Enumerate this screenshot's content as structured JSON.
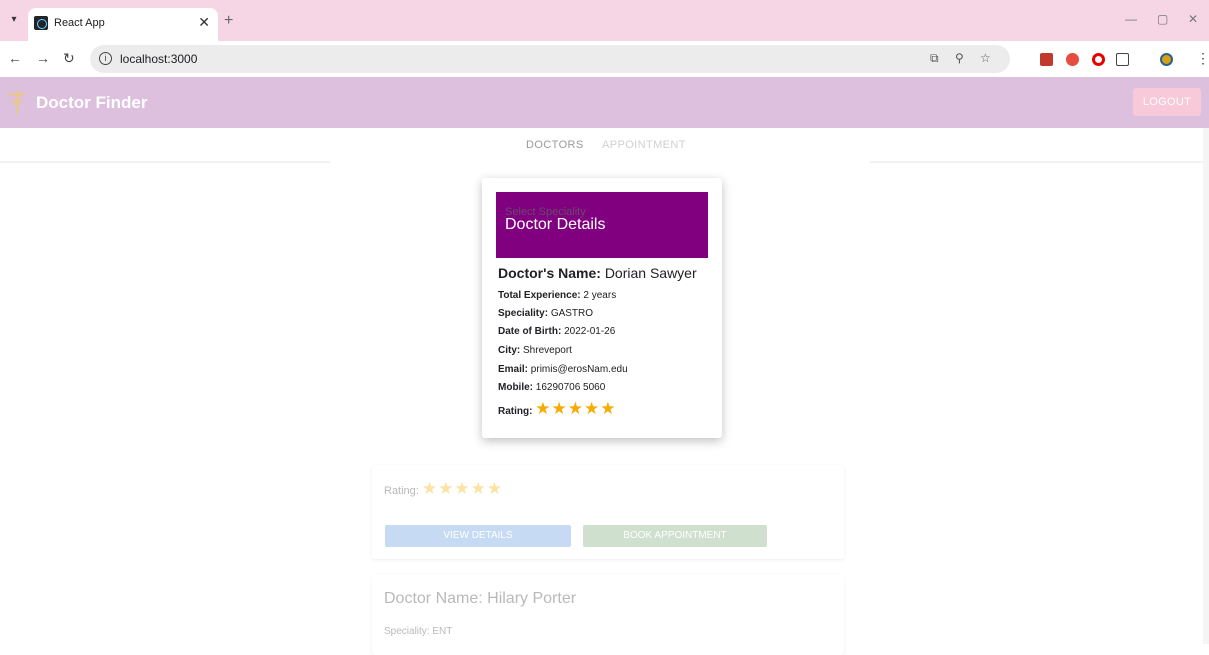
{
  "browser": {
    "tab_title": "React App",
    "url": "localhost:3000"
  },
  "app": {
    "brand": "Doctor Finder",
    "logout_label": "LOGOUT",
    "nav": {
      "doctors": "DOCTORS",
      "appointment": "APPOINTMENT"
    },
    "select_label": "Select Speciality"
  },
  "modal": {
    "title": "Doctor Details",
    "name_label": "Doctor's Name:",
    "name_value": "Dorian Sawyer",
    "experience_label": "Total Experience:",
    "experience_value": "2 years",
    "speciality_label": "Speciality:",
    "speciality_value": "GASTRO",
    "dob_label": "Date of Birth:",
    "dob_value": "2022-01-26",
    "city_label": "City:",
    "city_value": "Shreveport",
    "email_label": "Email:",
    "email_value": "primis@erosNam.edu",
    "mobile_label": "Mobile:",
    "mobile_value": "16290706 5060",
    "rating_label": "Rating:",
    "rating_stars": 5
  },
  "background_list": {
    "card1": {
      "rating_label": "Rating:",
      "rating_stars": 5,
      "view_label": "VIEW DETAILS",
      "book_label": "BOOK APPOINTMENT"
    },
    "card2": {
      "name_text": "Doctor Name: Hilary Porter",
      "speciality_text": "Speciality: ENT"
    }
  },
  "colors": {
    "appbar": "#ddbfde",
    "modal_header": "#800080",
    "star": "#f5ab00",
    "tabbar": "#f6d6e4"
  }
}
